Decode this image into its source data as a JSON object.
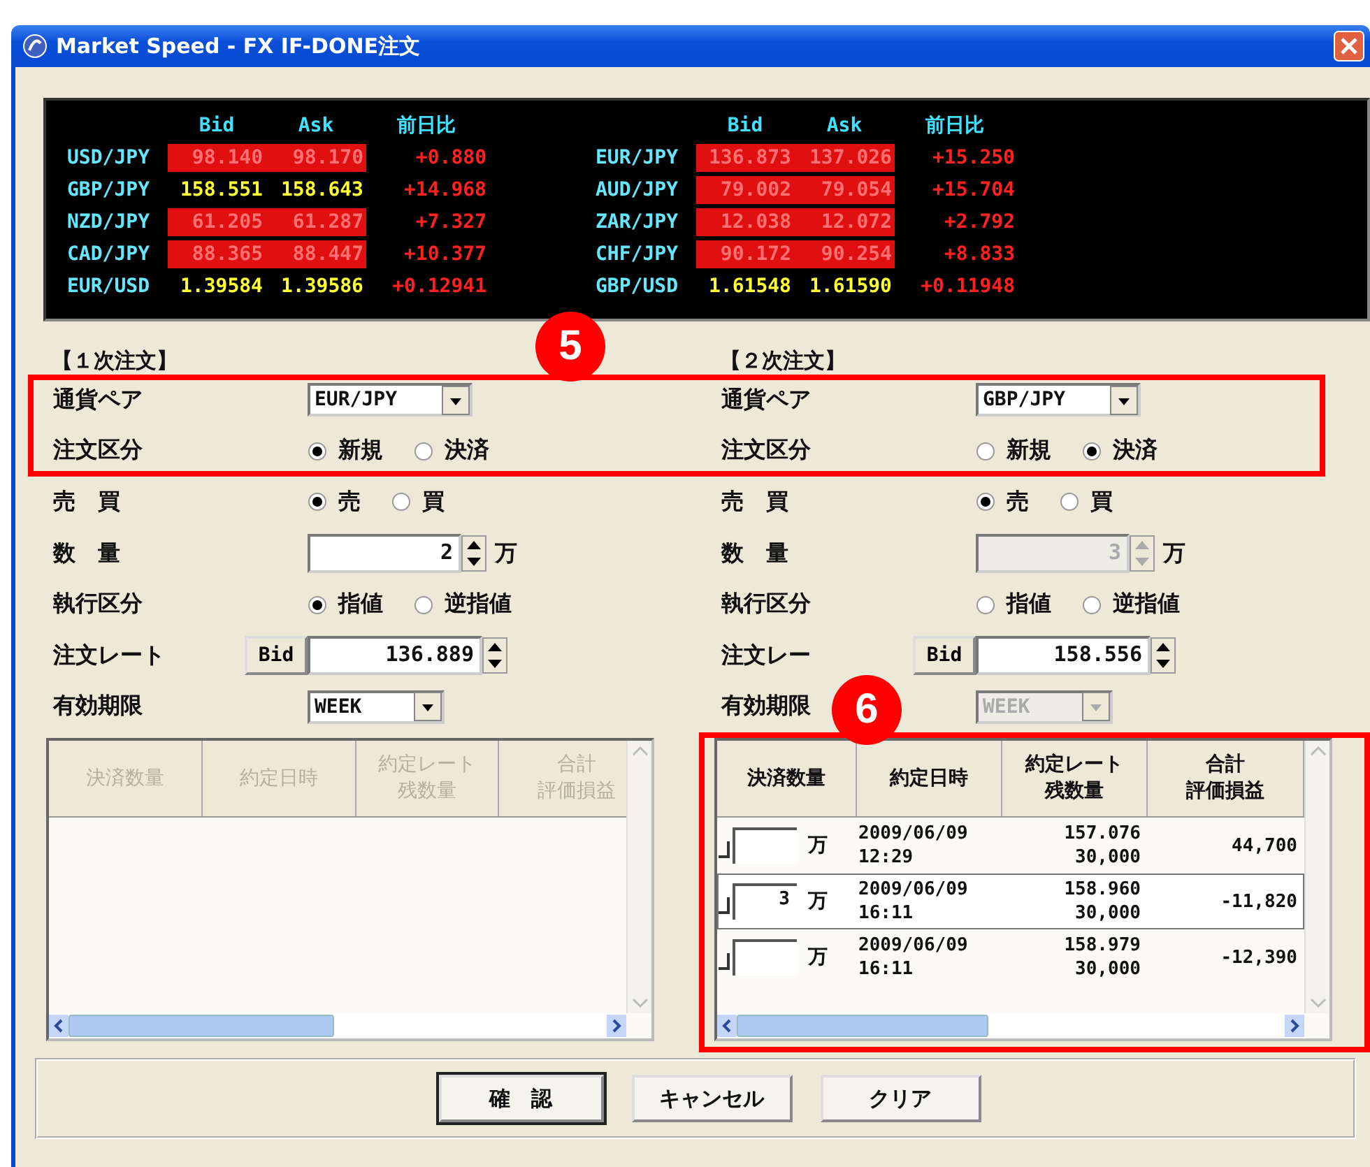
{
  "window": {
    "title": "Market Speed - FX IF-DONE注文"
  },
  "ticker": {
    "groups": [
      {
        "headers": [
          "Bid",
          "Ask",
          "前日比"
        ],
        "rows": [
          {
            "pair": "USD/JPY",
            "bid": "98.140",
            "bid_highlight": true,
            "ask": "98.170",
            "ask_highlight": true,
            "change": "+0.880"
          },
          {
            "pair": "GBP/JPY",
            "bid": "158.551",
            "bid_highlight": false,
            "ask": "158.643",
            "ask_highlight": false,
            "change": "+14.968"
          },
          {
            "pair": "NZD/JPY",
            "bid": "61.205",
            "bid_highlight": true,
            "ask": "61.287",
            "ask_highlight": true,
            "change": "+7.327"
          },
          {
            "pair": "CAD/JPY",
            "bid": "88.365",
            "bid_highlight": true,
            "ask": "88.447",
            "ask_highlight": true,
            "change": "+10.377"
          },
          {
            "pair": "EUR/USD",
            "bid": "1.39584",
            "bid_highlight": false,
            "ask": "1.39586",
            "ask_highlight": false,
            "change": "+0.12941"
          }
        ]
      },
      {
        "headers": [
          "Bid",
          "Ask",
          "前日比"
        ],
        "rows": [
          {
            "pair": "EUR/JPY",
            "bid": "136.873",
            "bid_highlight": true,
            "ask": "137.026",
            "ask_highlight": true,
            "change": "+15.250"
          },
          {
            "pair": "AUD/JPY",
            "bid": "79.002",
            "bid_highlight": true,
            "ask": "79.054",
            "ask_highlight": true,
            "change": "+15.704"
          },
          {
            "pair": "ZAR/JPY",
            "bid": "12.038",
            "bid_highlight": true,
            "ask": "12.072",
            "ask_highlight": true,
            "change": "+2.792"
          },
          {
            "pair": "CHF/JPY",
            "bid": "90.172",
            "bid_highlight": true,
            "ask": "90.254",
            "ask_highlight": true,
            "change": "+8.833"
          },
          {
            "pair": "GBP/USD",
            "bid": "1.61548",
            "bid_highlight": false,
            "ask": "1.61590",
            "ask_highlight": false,
            "change": "+0.11948"
          }
        ]
      }
    ]
  },
  "orders": [
    {
      "title": "【１次注文】",
      "rows": [
        {
          "kind": "select",
          "label": "通貨ペア",
          "value": "EUR/JPY",
          "disabled": false
        },
        {
          "kind": "radio",
          "label": "注文区分",
          "options": [
            {
              "label": "新規",
              "selected": true
            },
            {
              "label": "決済",
              "selected": false
            }
          ]
        },
        {
          "kind": "radio",
          "label": "売　買",
          "options": [
            {
              "label": "売",
              "selected": true
            },
            {
              "label": "買",
              "selected": false
            }
          ]
        },
        {
          "kind": "spinner",
          "label": "数　量",
          "value": "2",
          "unit": "万",
          "disabled": false
        },
        {
          "kind": "radio",
          "label": "執行区分",
          "options": [
            {
              "label": "指値",
              "selected": true
            },
            {
              "label": "逆指値",
              "selected": false
            }
          ]
        },
        {
          "kind": "rate",
          "label": "注文レート",
          "button": "Bid",
          "value": "136.889"
        },
        {
          "kind": "select",
          "label": "有効期限",
          "value": "WEEK",
          "disabled": false
        }
      ],
      "table": {
        "disabled": true,
        "columns": [
          {
            "lines": [
              "決済数量"
            ]
          },
          {
            "lines": [
              "約定日時"
            ]
          },
          {
            "lines": [
              "約定レート",
              "残数量"
            ]
          },
          {
            "lines": [
              "合計",
              "評価損益"
            ]
          }
        ]
      }
    },
    {
      "title": "【２次注文】",
      "rows": [
        {
          "kind": "select",
          "label": "通貨ペア",
          "value": "GBP/JPY",
          "disabled": false
        },
        {
          "kind": "radio",
          "label": "注文区分",
          "options": [
            {
              "label": "新規",
              "selected": false
            },
            {
              "label": "決済",
              "selected": true
            }
          ]
        },
        {
          "kind": "radio",
          "label": "売　買",
          "options": [
            {
              "label": "売",
              "selected": true
            },
            {
              "label": "買",
              "selected": false
            }
          ]
        },
        {
          "kind": "spinner",
          "label": "数　量",
          "value": "3",
          "unit": "万",
          "disabled": true
        },
        {
          "kind": "radio",
          "label": "執行区分",
          "options": [
            {
              "label": "指値",
              "selected": false
            },
            {
              "label": "逆指値",
              "selected": false
            }
          ]
        },
        {
          "kind": "rate",
          "label": "注文レー",
          "button": "Bid",
          "value": "158.556"
        },
        {
          "kind": "select",
          "label": "有効期限",
          "value": "WEEK",
          "disabled": true
        }
      ],
      "table": {
        "disabled": false,
        "columns": [
          {
            "lines": [
              "決済数量"
            ]
          },
          {
            "lines": [
              "約定日時"
            ]
          },
          {
            "lines": [
              "約定レート",
              "残数量"
            ]
          },
          {
            "lines": [
              "合計",
              "評価損益"
            ]
          }
        ],
        "rows": [
          {
            "selected": false,
            "checked": false,
            "unit": "万",
            "date": "2009/06/09",
            "time": "12:29",
            "rate": "157.076",
            "remaining": "30,000",
            "pl": "44,700"
          },
          {
            "selected": true,
            "checked": false,
            "amount": "3",
            "unit": "万",
            "date": "2009/06/09",
            "time": "16:11",
            "rate": "158.960",
            "remaining": "30,000",
            "pl": "-11,820"
          },
          {
            "selected": false,
            "checked": false,
            "unit": "万",
            "date": "2009/06/09",
            "time": "16:11",
            "rate": "158.979",
            "remaining": "30,000",
            "pl": "-12,390"
          }
        ]
      }
    }
  ],
  "buttons": [
    {
      "label": "確　認",
      "default": true
    },
    {
      "label": "キャンセル",
      "default": false
    },
    {
      "label": "クリア",
      "default": false
    }
  ],
  "annotations": [
    {
      "label": "5"
    },
    {
      "label": "6"
    }
  ]
}
